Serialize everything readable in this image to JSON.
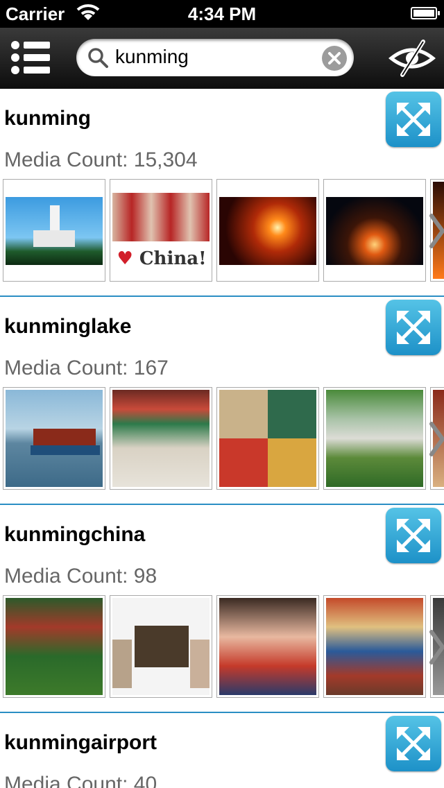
{
  "status": {
    "carrier": "Carrier",
    "time": "4:34 PM"
  },
  "search": {
    "query": "kunming"
  },
  "icons": {
    "menu": "list-icon",
    "search": "search-icon",
    "clear": "clear-icon",
    "visibility": "eye-slash-icon",
    "expand": "expand-arrows-icon"
  },
  "colors": {
    "accent": "#2a8ec4",
    "button": "#3aa8d8"
  },
  "results": [
    {
      "tag": "kunming",
      "media_label": "Media Count: 15,304"
    },
    {
      "tag": "kunminglake",
      "media_label": "Media Count: 167"
    },
    {
      "tag": "kunmingchina",
      "media_label": "Media Count: 98"
    },
    {
      "tag": "kunmingairport",
      "media_label": "Media Count: 40"
    }
  ],
  "thumbnails": [
    [
      "pagoda-sky-photo",
      "girls-china-photo",
      "sparkler-photo",
      "campfire-photo"
    ],
    [
      "lake-boat-photo",
      "corridor-photo",
      "palace-collage-photo",
      "stone-bridge-photo"
    ],
    [
      "garden-gate-photo",
      "pavilion-collage-photo",
      "kids-group-photo",
      "temple-statue-photo"
    ]
  ],
  "overlay_caption": "China!"
}
